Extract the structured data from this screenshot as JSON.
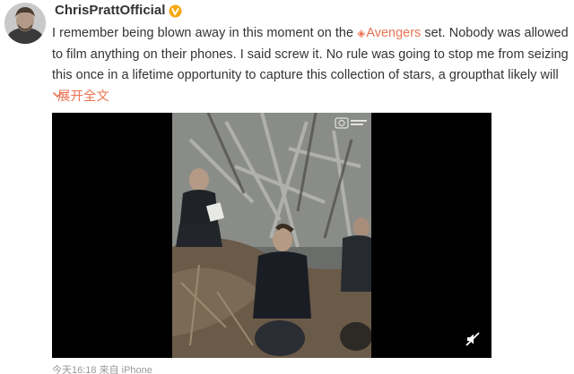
{
  "post": {
    "author": "ChrisPrattOfficial",
    "text_before_tag": "I remember being blown away in this moment on the ",
    "tag": "Avengers",
    "text_after_tag": " set. Nobody was allowed to film anything on their phones. I said screw it. No rule was going to stop me from seizing this once in a lifetime opportunity to capture this collection of stars, a groupthat likely will",
    "expand_label": "展开全文",
    "footer_meta": "今天16:18 来自 iPhone"
  },
  "icons": {
    "verified": "verified-badge-icon",
    "tag": "diamond-icon",
    "expand": "chevron-down-icon",
    "mute": "muted-speaker-icon"
  },
  "colors": {
    "link": "#eb7350",
    "verified": "#f7a80e",
    "text": "#333333",
    "meta": "#999999"
  }
}
